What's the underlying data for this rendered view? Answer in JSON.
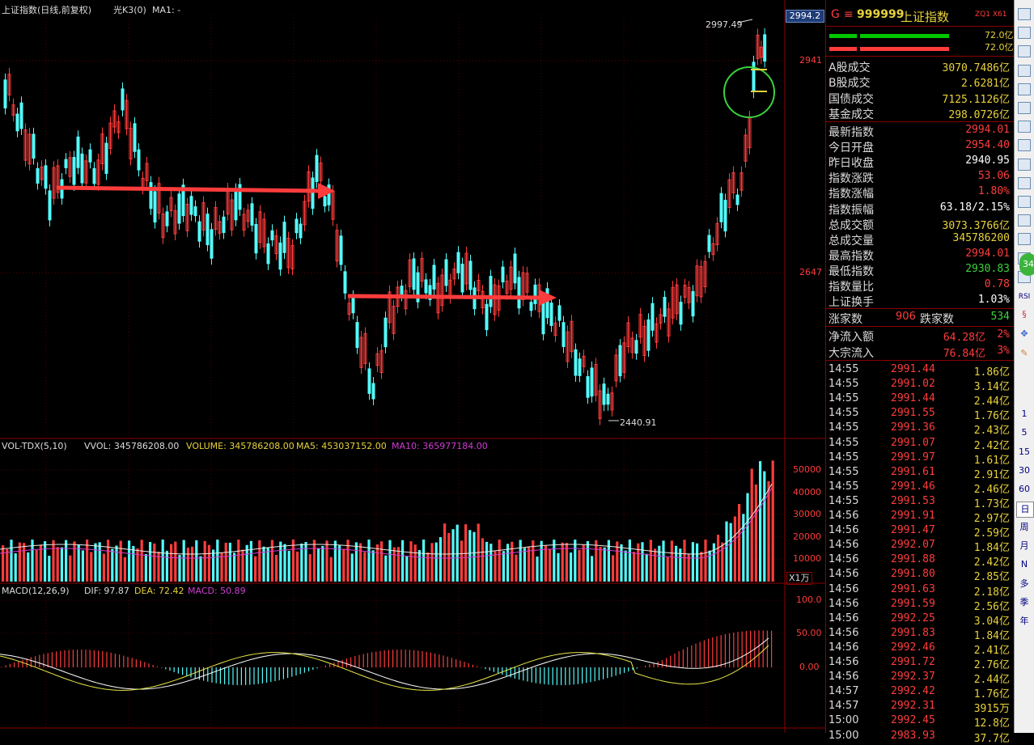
{
  "main_chart": {
    "title": "上证指数(日线,前复权)",
    "indicator1": "光K3(0)",
    "indicator2": "MA1: -",
    "price_box": "2994.2",
    "y_labels": [
      "2941",
      "2647"
    ],
    "high_label": "2997.49",
    "low_label": "2440.91"
  },
  "volume_panel": {
    "name": "VOL-TDX(5,10)",
    "vvol": "VVOL: 345786208.00",
    "volume": "VOLUME: 345786208.00",
    "ma5": "MA5: 453037152.00",
    "ma10": "MA10: 365977184.00",
    "y_labels": [
      "50000",
      "40000",
      "30000",
      "20000",
      "10000"
    ],
    "unit": "X1万"
  },
  "macd_panel": {
    "name": "MACD(12,26,9)",
    "dif": "DIF: 97.87",
    "dea": "DEA: 72.42",
    "macd": "MACD: 50.89",
    "y_labels": [
      "100.0",
      "50.00",
      "0.00"
    ]
  },
  "right_panel": {
    "title_g": "G",
    "title_eq": "≡",
    "code": "999999",
    "name": "上证指数",
    "tag": "ZQ1 X61",
    "bar1_val": "72.0亿",
    "bar2_val": "72.0亿",
    "stats": [
      {
        "label": "A股成交",
        "value": "3070.7486亿",
        "color": "#e8d23c"
      },
      {
        "label": "B股成交",
        "value": "2.6281亿",
        "color": "#e8d23c"
      },
      {
        "label": "国债成交",
        "value": "7125.1126亿",
        "color": "#e8d23c"
      },
      {
        "label": "基金成交",
        "value": "298.0726亿",
        "color": "#e8d23c"
      }
    ],
    "quote": [
      {
        "label": "最新指数",
        "value": "2994.01",
        "color": "#ff3c3c"
      },
      {
        "label": "今日开盘",
        "value": "2954.40",
        "color": "#ff3c3c"
      },
      {
        "label": "昨日收盘",
        "value": "2940.95",
        "color": "#ffffff"
      },
      {
        "label": "指数涨跌",
        "value": "53.06",
        "color": "#ff3c3c"
      },
      {
        "label": "指数涨幅",
        "value": "1.80%",
        "color": "#ff3c3c"
      },
      {
        "label": "指数振幅",
        "value": "63.18/2.15%",
        "color": "#ffffff"
      },
      {
        "label": "总成交额",
        "value": "3073.3766亿",
        "color": "#e8d23c"
      },
      {
        "label": "总成交量",
        "value": "345786200",
        "color": "#e8d23c"
      },
      {
        "label": "最高指数",
        "value": "2994.01",
        "color": "#ff3c3c"
      },
      {
        "label": "最低指数",
        "value": "2930.83",
        "color": "#3cd23c"
      },
      {
        "label": "指数量比",
        "value": "0.78",
        "color": "#ff3c3c"
      },
      {
        "label": "上证换手",
        "value": "1.03%",
        "color": "#ffffff"
      }
    ],
    "rise_label": "涨家数",
    "rise_val": "906",
    "fall_label": "跌家数",
    "fall_val": "534",
    "flow": [
      {
        "label": "净流入额",
        "value": "64.28亿",
        "pct": "2%"
      },
      {
        "label": "大宗流入",
        "value": "76.84亿",
        "pct": "3%"
      }
    ],
    "ticks": [
      [
        "14:55",
        "2991.44",
        "1.86亿"
      ],
      [
        "14:55",
        "2991.02",
        "3.14亿"
      ],
      [
        "14:55",
        "2991.44",
        "2.44亿"
      ],
      [
        "14:55",
        "2991.55",
        "1.76亿"
      ],
      [
        "14:55",
        "2991.36",
        "2.43亿"
      ],
      [
        "14:55",
        "2991.07",
        "2.42亿"
      ],
      [
        "14:55",
        "2991.97",
        "1.61亿"
      ],
      [
        "14:55",
        "2991.61",
        "2.91亿"
      ],
      [
        "14:55",
        "2991.46",
        "2.46亿"
      ],
      [
        "14:55",
        "2991.53",
        "1.73亿"
      ],
      [
        "14:56",
        "2991.91",
        "2.97亿"
      ],
      [
        "14:56",
        "2991.47",
        "2.59亿"
      ],
      [
        "14:56",
        "2992.07",
        "1.84亿"
      ],
      [
        "14:56",
        "2991.88",
        "2.42亿"
      ],
      [
        "14:56",
        "2991.80",
        "2.85亿"
      ],
      [
        "14:56",
        "2991.63",
        "2.18亿"
      ],
      [
        "14:56",
        "2991.59",
        "2.56亿"
      ],
      [
        "14:56",
        "2992.25",
        "3.04亿"
      ],
      [
        "14:56",
        "2991.83",
        "1.84亿"
      ],
      [
        "14:56",
        "2992.46",
        "2.41亿"
      ],
      [
        "14:56",
        "2991.72",
        "2.76亿"
      ],
      [
        "14:56",
        "2992.37",
        "2.44亿"
      ],
      [
        "14:57",
        "2992.42",
        "1.76亿"
      ],
      [
        "14:57",
        "2992.31",
        "3915万"
      ],
      [
        "15:00",
        "2992.45",
        "12.8亿"
      ],
      [
        "15:00",
        "2983.93",
        "37.7亿"
      ]
    ]
  },
  "toolbar": {
    "periods": [
      "1",
      "5",
      "15",
      "30",
      "60",
      "日",
      "周",
      "月",
      "N",
      "多",
      "季",
      "年"
    ],
    "rsi": "RSI",
    "badge": "34"
  }
}
